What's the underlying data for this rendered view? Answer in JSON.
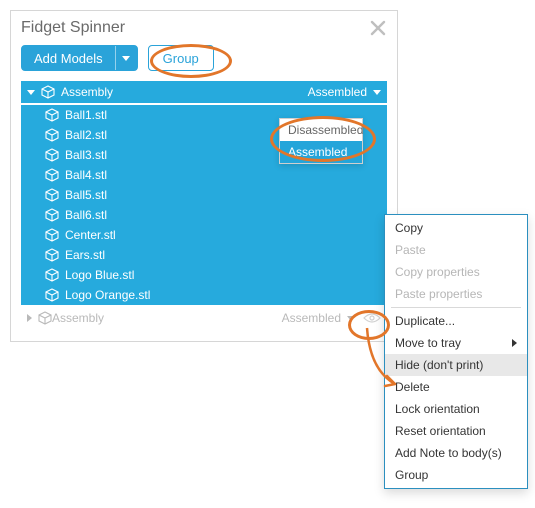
{
  "panel": {
    "title": "Fidget Spinner",
    "addModelsLabel": "Add Models",
    "groupLabel": "Group"
  },
  "tree": {
    "header": {
      "label": "Assembly",
      "state": "Assembled"
    },
    "items": [
      {
        "label": "Ball1.stl"
      },
      {
        "label": "Ball2.stl"
      },
      {
        "label": "Ball3.stl"
      },
      {
        "label": "Ball4.stl"
      },
      {
        "label": "Ball5.stl"
      },
      {
        "label": "Ball6.stl"
      },
      {
        "label": "Center.stl"
      },
      {
        "label": "Ears.stl"
      },
      {
        "label": "Logo Blue.stl"
      },
      {
        "label": "Logo Orange.stl"
      }
    ],
    "collapsed": {
      "label": "Assembly",
      "state": "Assembled"
    }
  },
  "statePopover": {
    "options": [
      {
        "label": "Disassembled",
        "selected": false
      },
      {
        "label": "Assembled",
        "selected": true
      }
    ]
  },
  "contextMenu": {
    "items": [
      {
        "label": "Copy",
        "enabled": true
      },
      {
        "label": "Paste",
        "enabled": false
      },
      {
        "label": "Copy properties",
        "enabled": false
      },
      {
        "label": "Paste properties",
        "enabled": false
      },
      {
        "sep": true
      },
      {
        "label": "Duplicate...",
        "enabled": true
      },
      {
        "label": "Move to tray",
        "enabled": true,
        "submenu": true
      },
      {
        "label": "Hide (don't print)",
        "enabled": true,
        "hover": true
      },
      {
        "label": "Delete",
        "enabled": true
      },
      {
        "label": "Lock orientation",
        "enabled": true
      },
      {
        "label": "Reset orientation",
        "enabled": true
      },
      {
        "label": "Add Note to body(s)",
        "enabled": true
      },
      {
        "label": "Group",
        "enabled": true
      }
    ]
  }
}
